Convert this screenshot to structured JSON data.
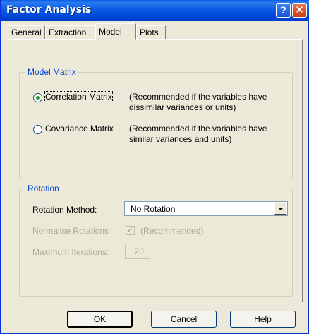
{
  "window": {
    "title": "Factor Analysis",
    "help_glyph": "?",
    "close_glyph": "✕"
  },
  "tabs": [
    {
      "label": "General"
    },
    {
      "label": "Extraction"
    },
    {
      "label": "Model"
    },
    {
      "label": "Plots"
    }
  ],
  "model_matrix": {
    "group_label": "Model Matrix",
    "correlation": {
      "label": "Correlation Matrix",
      "desc_line1": "(Recommended if the variables have",
      "desc_line2": "dissimilar variances or units)",
      "checked": true
    },
    "covariance": {
      "label": "Covariance Matrix",
      "desc_line1": "(Recommended if the variables have",
      "desc_line2": "similar variances and  units)",
      "checked": false
    }
  },
  "rotation": {
    "group_label": "Rotation",
    "method_label": "Rotation Method:",
    "method_value": "No Rotation",
    "normalise_label": "Normalise Rotations",
    "normalise_check": "✓",
    "recommended_text": "(Recommended)",
    "max_iter_label": "Maximum Iterations:",
    "max_iter_value": "20"
  },
  "buttons": {
    "ok": "OK",
    "cancel": "Cancel",
    "help": "Help"
  },
  "colors": {
    "titlebar": "#0054e3",
    "group_label": "#0046d5",
    "radio_dot": "#21a121",
    "disabled_text": "#aca899"
  }
}
